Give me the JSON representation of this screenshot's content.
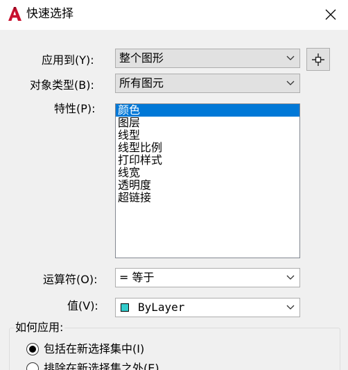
{
  "window": {
    "title": "快速选择",
    "logo_letter": "A"
  },
  "form": {
    "apply_to_label": "应用到(Y):",
    "apply_to_value": "整个图形",
    "object_type_label": "对象类型(B):",
    "object_type_value": "所有图元",
    "properties_label": "特性(P):",
    "properties": [
      "颜色",
      "图层",
      "线型",
      "线型比例",
      "打印样式",
      "线宽",
      "透明度",
      "超链接"
    ],
    "selected_property": "颜色",
    "operator_label": "运算符(O):",
    "operator_value": "= 等于",
    "value_label": "值(V):",
    "value_value": "ByLayer",
    "value_swatch_color": "#33cccc"
  },
  "apply_how": {
    "group_label": "如何应用:",
    "option_include": "包括在新选择集中(I)",
    "option_exclude": "排除在新选择集之外(E)",
    "selected": "include"
  },
  "colors": {
    "selection": "#0078d7",
    "logo": "#c8102e"
  }
}
